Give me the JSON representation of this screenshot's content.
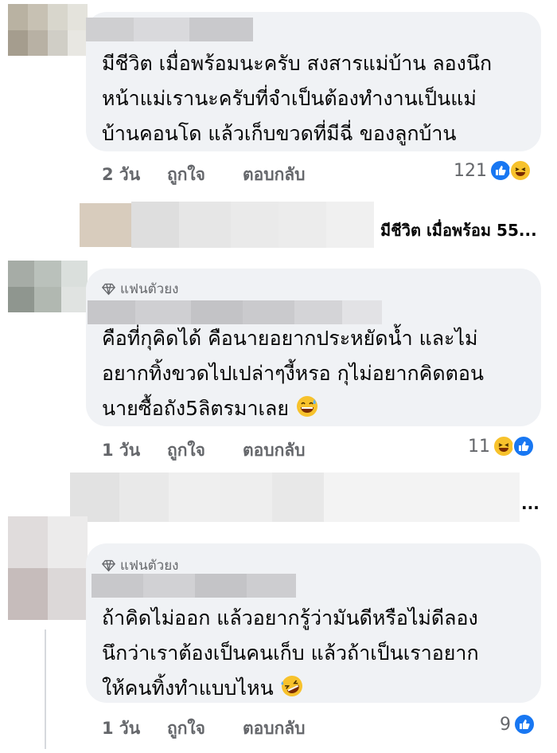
{
  "comments": [
    {
      "badge": "",
      "lines": [
        "มีชีวิต เมื่อพร้อมนะครับ สงสารแม่บ้าน ลองนึก",
        "หน้าแม่เรานะครับที่จำเป็นต้องทำงานเป็นแม่",
        "บ้านคอนโด แล้วเก็บขวดที่มีฉี่ ของลูกบ้าน"
      ],
      "time": "2 วัน",
      "like_label": "ถูกใจ",
      "reply_label": "ตอบกลับ",
      "reaction_count": "121",
      "reactions": [
        "like",
        "haha"
      ]
    },
    {
      "badge": "แฟนตัวยง",
      "lines": [
        "คือที่กุคิดได้ คือนายอยากประหยัดน้ำ และไม่",
        "อยากทิ้งขวดไปเปล่าๆงี้หรอ กุไม่อยากคิดตอน",
        "นายซื้อถัง5ลิตรมาเลย"
      ],
      "time": "1 วัน",
      "like_label": "ถูกใจ",
      "reply_label": "ตอบกลับ",
      "reaction_count": "11",
      "reactions": [
        "haha",
        "like"
      ]
    },
    {
      "badge": "แฟนตัวยง",
      "lines": [
        "ถ้าคิดไม่ออก แล้วอยากรู้ว่ามันดีหรือไม่ดีลอง",
        "นึกว่าเราต้องเป็นคนเก็บ แล้วถ้าเป็นเราอยาก",
        "ให้คนทิ้งทำแบบไหน"
      ],
      "time": "1 วัน",
      "like_label": "ถูกใจ",
      "reply_label": "ตอบกลับ",
      "reaction_count": "9",
      "reactions": [
        "like"
      ]
    }
  ],
  "reply_previews": [
    {
      "text": "มีชีวิต เมื่อพร้อม 55..."
    },
    {
      "text": "..."
    }
  ],
  "colors": {
    "bubble": "#f0f2f5",
    "meta_text": "#65676b",
    "like_blue": "#1877f2",
    "haha_yellow": "#f7c22c"
  },
  "icons": [
    "diamond-icon",
    "like-reaction-icon",
    "haha-reaction-icon",
    "sweat-smile-emoji-icon",
    "rofl-emoji-icon"
  ]
}
